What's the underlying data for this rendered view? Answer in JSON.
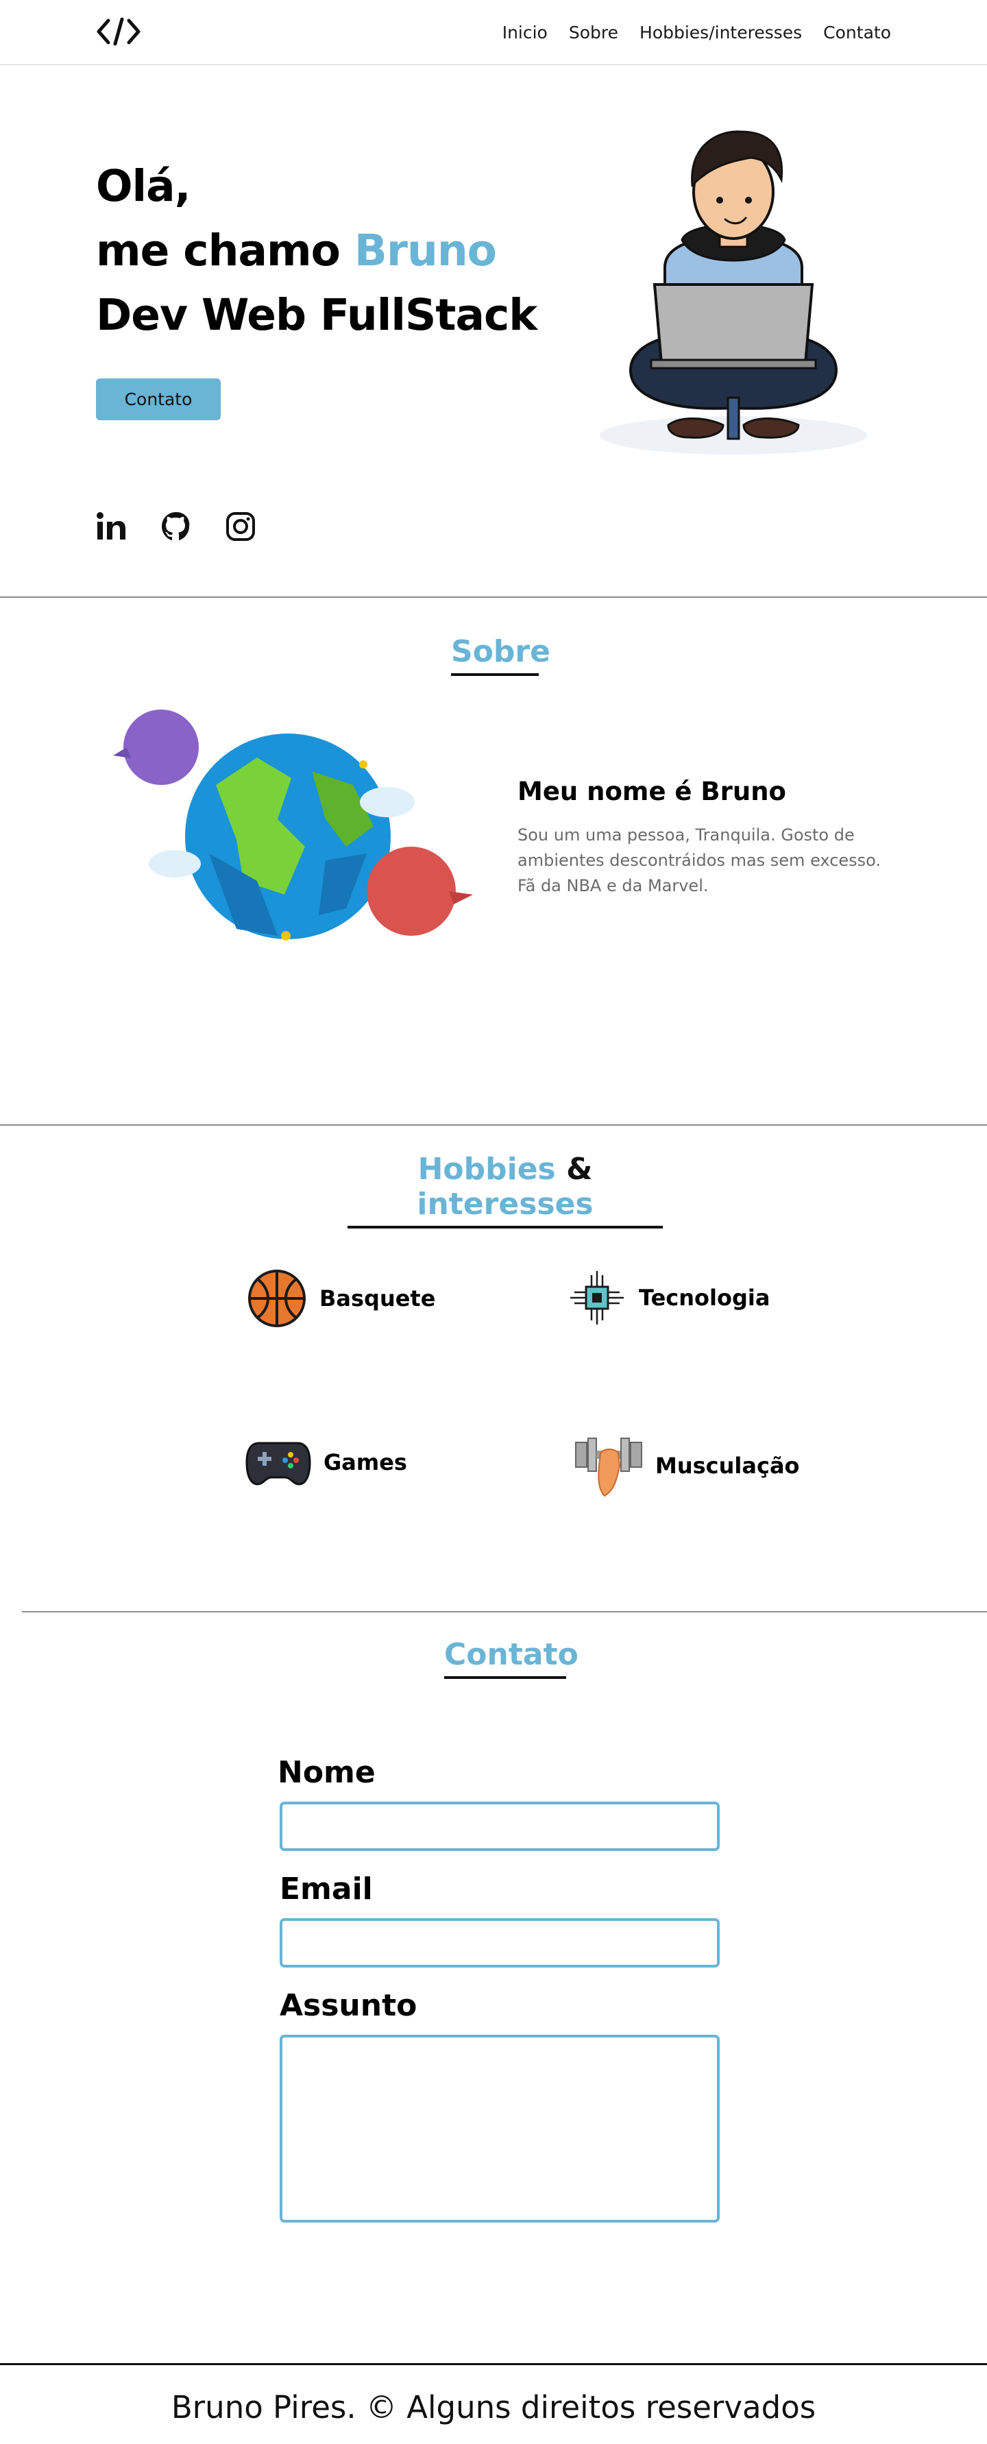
{
  "header": {
    "logo_icon": "code-brackets-icon",
    "nav": [
      "Inicio",
      "Sobre",
      "Hobbies/interesses",
      "Contato"
    ]
  },
  "hero": {
    "line1": "Olá,",
    "line2_prefix": "me chamo",
    "line2_name": "Bruno",
    "line3": "Dev Web FullStack",
    "button": "Contato",
    "social_icons": [
      "linkedin-icon",
      "github-icon",
      "instagram-icon"
    ]
  },
  "about": {
    "title": "Sobre",
    "heading": "Meu nome é Bruno",
    "text": "Sou um uma pessoa, Tranquila. Gosto de ambientes descontráidos mas sem excesso. Fã da NBA e da Marvel."
  },
  "hobbies": {
    "title_part1": "Hobbies",
    "title_amp": "&",
    "title_part2": "interesses",
    "items": [
      {
        "label": "Basquete",
        "icon": "basketball-icon"
      },
      {
        "label": "Tecnologia",
        "icon": "chip-icon"
      },
      {
        "label": "Games",
        "icon": "gamepad-icon"
      },
      {
        "label": "Musculação",
        "icon": "dumbbell-arm-icon"
      }
    ]
  },
  "contact": {
    "title": "Contato",
    "fields": {
      "name_label": "Nome",
      "email_label": "Email",
      "subject_label": "Assunto"
    }
  },
  "footer": {
    "text": "Bruno Pires. © Alguns direitos reservados"
  },
  "colors": {
    "accent": "#6ab4d6",
    "text": "#000000",
    "muted": "#6a6a6a"
  }
}
